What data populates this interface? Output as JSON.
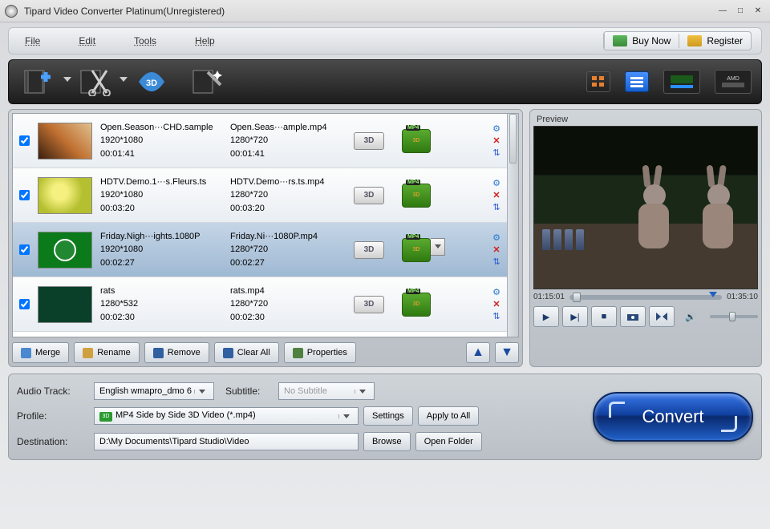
{
  "titlebar": {
    "title": "Tipard Video Converter Platinum(Unregistered)"
  },
  "menubar": {
    "items": [
      "File",
      "Edit",
      "Tools",
      "Help"
    ],
    "buy": "Buy Now",
    "register": "Register"
  },
  "files": [
    {
      "checked": true,
      "src_name": "Open.Season···CHD.sample",
      "src_res": "1920*1080",
      "src_dur": "00:01:41",
      "out_name": "Open.Seas···ample.mp4",
      "out_res": "1280*720",
      "out_dur": "00:01:41",
      "selected": false
    },
    {
      "checked": true,
      "src_name": "HDTV.Demo.1···s.Fleurs.ts",
      "src_res": "1920*1080",
      "src_dur": "00:03:20",
      "out_name": "HDTV.Demo···rs.ts.mp4",
      "out_res": "1280*720",
      "out_dur": "00:03:20",
      "selected": false
    },
    {
      "checked": true,
      "src_name": "Friday.Nigh···ights.1080P",
      "src_res": "1920*1080",
      "src_dur": "00:02:27",
      "out_name": "Friday.Ni···1080P.mp4",
      "out_res": "1280*720",
      "out_dur": "00:02:27",
      "selected": true
    },
    {
      "checked": true,
      "src_name": "rats",
      "src_res": "1280*532",
      "src_dur": "00:02:30",
      "out_name": "rats.mp4",
      "out_res": "1280*720",
      "out_dur": "00:02:30",
      "selected": false
    }
  ],
  "threed_label": "3D",
  "actions": {
    "merge": "Merge",
    "rename": "Rename",
    "remove": "Remove",
    "clearall": "Clear All",
    "properties": "Properties"
  },
  "preview": {
    "label": "Preview",
    "time_start": "01:15:01",
    "time_end": "01:35:10"
  },
  "bottom": {
    "audio_track_label": "Audio Track:",
    "audio_track_value": "English wmapro_dmo 6",
    "subtitle_label": "Subtitle:",
    "subtitle_value": "No Subtitle",
    "profile_label": "Profile:",
    "profile_badge": "3D",
    "profile_value": "MP4 Side by Side 3D Video (*.mp4)",
    "destination_label": "Destination:",
    "destination_value": "D:\\My Documents\\Tipard Studio\\Video",
    "settings": "Settings",
    "apply_all": "Apply to All",
    "browse": "Browse",
    "open_folder": "Open Folder",
    "convert": "Convert"
  }
}
